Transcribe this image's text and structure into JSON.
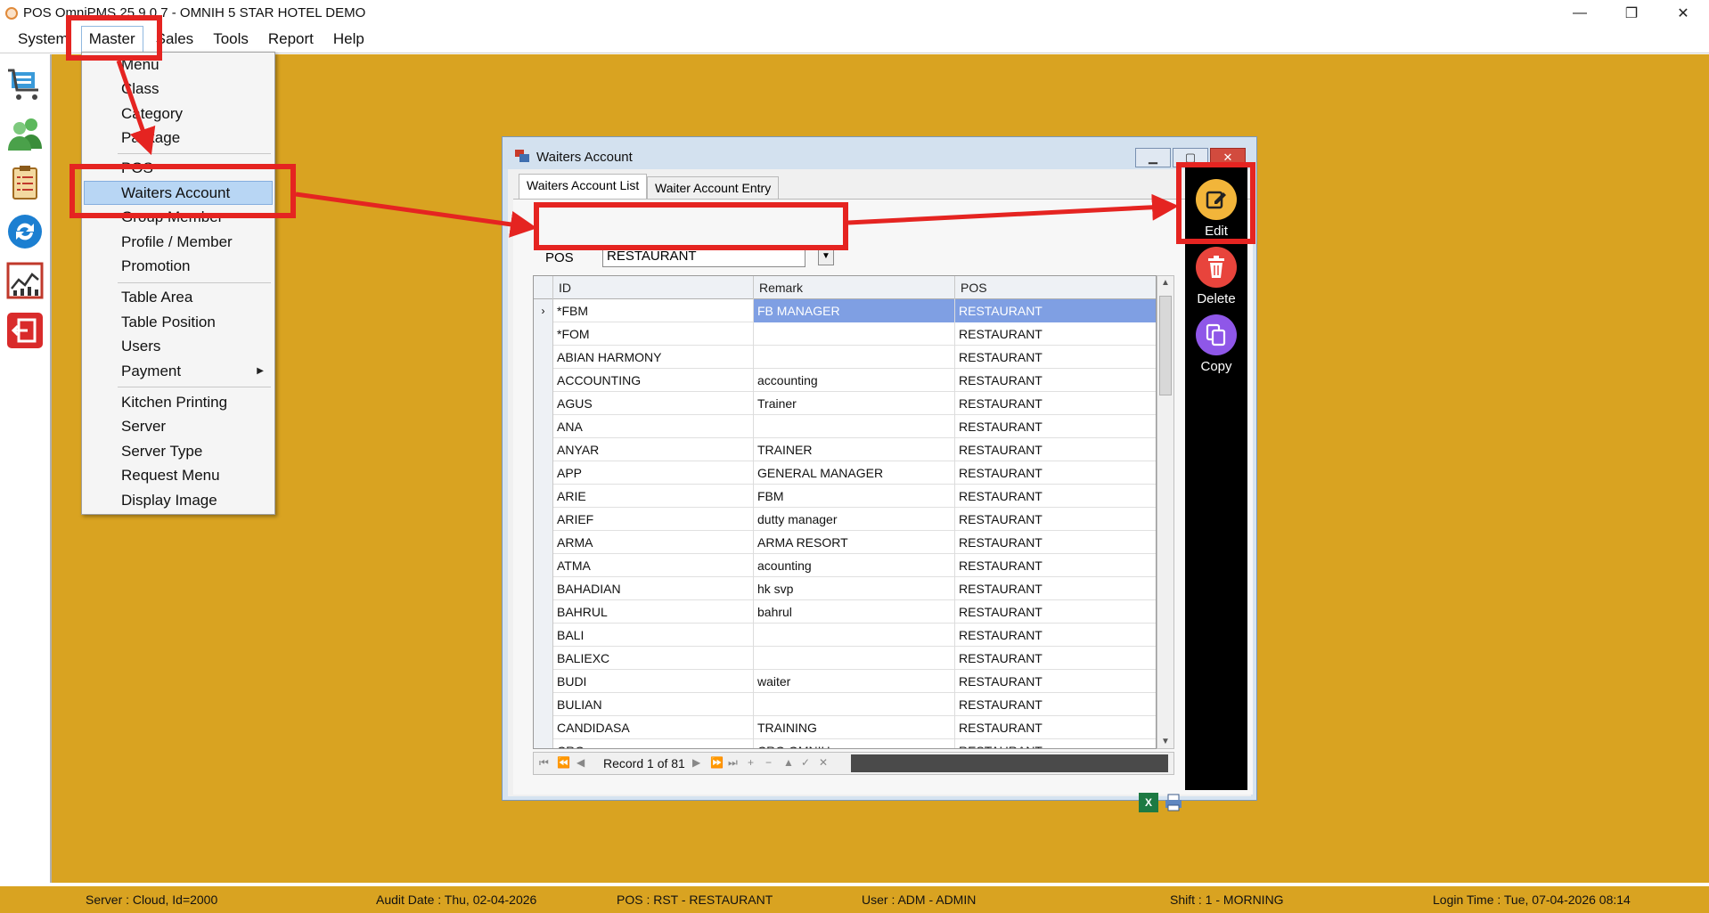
{
  "titlebar": {
    "title": "POS OmniPMS 25.9.0.7 - OMNIH 5 STAR HOTEL DEMO",
    "minimize": "—",
    "restore": "❐",
    "close": "✕"
  },
  "menubar": {
    "items": [
      "System",
      "Master",
      "Sales",
      "Tools",
      "Report",
      "Help"
    ]
  },
  "dropdown": {
    "items": [
      "Menu",
      "Class",
      "Category",
      "Package",
      "POS",
      "Waiters Account",
      "Group Member",
      "Profile / Member",
      "Promotion",
      "Table Area",
      "Table Position",
      "Users",
      "Payment",
      "Kitchen Printing",
      "Server",
      "Server Type",
      "Request Menu",
      "Display Image"
    ]
  },
  "window": {
    "title": "Waiters Account",
    "tabs": [
      "Waiters Account List",
      "Waiter Account Entry"
    ],
    "pos_label": "POS",
    "pos_value": "RESTAURANT",
    "columns": [
      "ID",
      "Remark",
      "POS"
    ],
    "rows": [
      [
        "*FBM",
        "FB MANAGER",
        "RESTAURANT"
      ],
      [
        "*FOM",
        "",
        "RESTAURANT"
      ],
      [
        "ABIAN HARMONY",
        "",
        "RESTAURANT"
      ],
      [
        "ACCOUNTING",
        "accounting",
        "RESTAURANT"
      ],
      [
        "AGUS",
        "Trainer",
        "RESTAURANT"
      ],
      [
        "ANA",
        "",
        "RESTAURANT"
      ],
      [
        "ANYAR",
        "TRAINER",
        "RESTAURANT"
      ],
      [
        "APP",
        "GENERAL MANAGER",
        "RESTAURANT"
      ],
      [
        "ARIE",
        "FBM",
        "RESTAURANT"
      ],
      [
        "ARIEF",
        "dutty manager",
        "RESTAURANT"
      ],
      [
        "ARMA",
        "ARMA RESORT",
        "RESTAURANT"
      ],
      [
        "ATMA",
        "acounting",
        "RESTAURANT"
      ],
      [
        "BAHADIAN",
        "hk svp",
        "RESTAURANT"
      ],
      [
        "BAHRUL",
        "bahrul",
        "RESTAURANT"
      ],
      [
        "BALI",
        "",
        "RESTAURANT"
      ],
      [
        "BALIEXC",
        "",
        "RESTAURANT"
      ],
      [
        "BUDI",
        "waiter",
        "RESTAURANT"
      ],
      [
        "BULIAN",
        "",
        "RESTAURANT"
      ],
      [
        "CANDIDASA",
        "TRAINING",
        "RESTAURANT"
      ],
      [
        "CRO",
        "CRO OMNIH",
        "RESTAURANT"
      ]
    ],
    "record_text": "Record 1 of 81"
  },
  "actions": {
    "edit": "Edit",
    "delete": "Delete",
    "copy": "Copy"
  },
  "status": {
    "server": "Server : Cloud, Id=2000",
    "audit": "Audit Date : Thu, 02-04-2026",
    "pos": "POS : RST - RESTAURANT",
    "user": "User : ADM - ADMIN",
    "shift": "Shift : 1 - MORNING",
    "login": "Login Time : Tue, 07-04-2026 08:14"
  },
  "colors": {
    "desktop": "#d9a321",
    "highlight": "#e52421",
    "edit": "#f2b53a",
    "delete": "#e8443c",
    "copy": "#8f57e8"
  }
}
